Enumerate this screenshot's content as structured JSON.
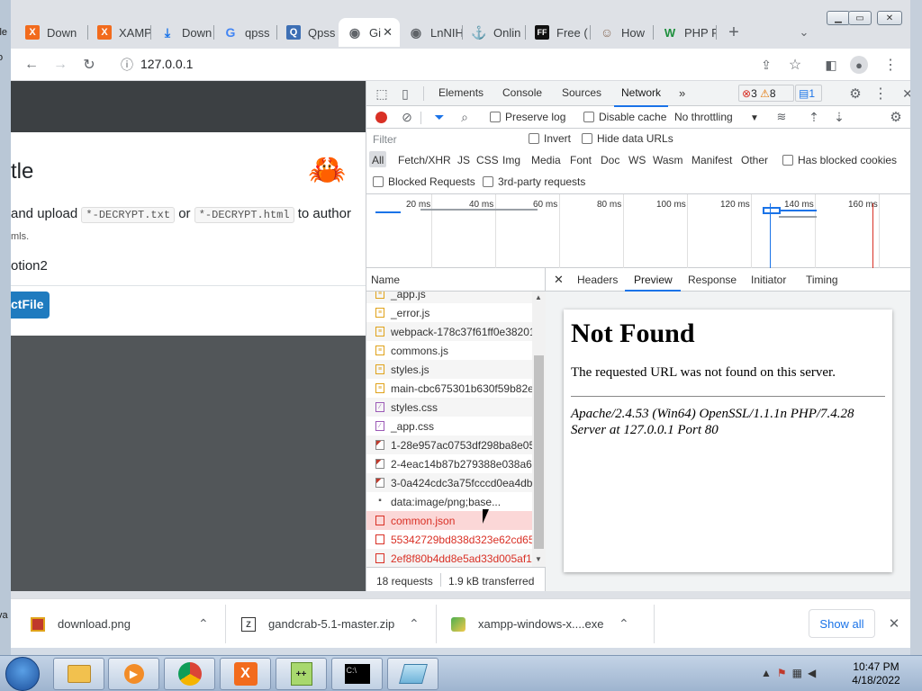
{
  "tabs": [
    {
      "label": "Down",
      "icon": "X",
      "icon_color": "#f26b1d"
    },
    {
      "label": "XAMP",
      "icon": "X",
      "icon_color": "#f26b1d"
    },
    {
      "label": "Down",
      "icon": "⤓",
      "icon_color": "#1a73e8"
    },
    {
      "label": "qpss",
      "icon": "G",
      "icon_color": "#4285f4"
    },
    {
      "label": "Qpss",
      "icon": "Q",
      "icon_color": "#e0403a"
    },
    {
      "label": "Gi",
      "icon": "◉",
      "icon_color": "#5f6368"
    },
    {
      "label": "LnNIH",
      "icon": "◉",
      "icon_color": "#5f6368"
    },
    {
      "label": "Onlin",
      "icon": "⚓",
      "icon_color": "#2e8b57"
    },
    {
      "label": "Free (",
      "icon": "FF",
      "icon_color": "#111111"
    },
    {
      "label": "How",
      "icon": "☺",
      "icon_color": "#8a6d5b"
    },
    {
      "label": "PHP F",
      "icon": "W",
      "icon_color": "#1d8f3c"
    }
  ],
  "toolbar": {
    "url": "127.0.0.1"
  },
  "page": {
    "title": "tle",
    "text_before": "and upload",
    "code1": "*-DECRYPT.txt",
    "or": "or",
    "code2": "*-DECRYPT.html",
    "text_after": "to author",
    "small": "mls.",
    "option": "otion2",
    "button": "ctFile"
  },
  "devtools": {
    "tabs": [
      "Elements",
      "Console",
      "Sources",
      "Network"
    ],
    "errors": "3",
    "warnings": "8",
    "messages": "1",
    "preserve_log": "Preserve log",
    "disable_cache": "Disable cache",
    "throttling": "No throttling",
    "filter_placeholder": "Filter",
    "invert": "Invert",
    "hide_data_urls": "Hide data URLs",
    "types": [
      "All",
      "Fetch/XHR",
      "JS",
      "CSS",
      "Img",
      "Media",
      "Font",
      "Doc",
      "WS",
      "Wasm",
      "Manifest",
      "Other"
    ],
    "has_blocked_cookies": "Has blocked cookies",
    "blocked_requests": "Blocked Requests",
    "third_party": "3rd-party requests",
    "ticks": [
      "20 ms",
      "40 ms",
      "60 ms",
      "80 ms",
      "100 ms",
      "120 ms",
      "140 ms",
      "160 ms"
    ],
    "name_header": "Name",
    "rows": [
      {
        "name": "_app.js",
        "type": "js",
        "state": "alt"
      },
      {
        "name": "_error.js",
        "type": "js",
        "state": ""
      },
      {
        "name": "webpack-178c37f61ff0e38201",
        "type": "js",
        "state": "alt"
      },
      {
        "name": "commons.js",
        "type": "js",
        "state": ""
      },
      {
        "name": "styles.js",
        "type": "js",
        "state": "alt"
      },
      {
        "name": "main-cbc675301b630f59b82e",
        "type": "js",
        "state": ""
      },
      {
        "name": "styles.css",
        "type": "css",
        "state": "alt"
      },
      {
        "name": "_app.css",
        "type": "css",
        "state": ""
      },
      {
        "name": "1-28e957ac0753df298ba8e05",
        "type": "img",
        "state": "alt"
      },
      {
        "name": "2-4eac14b87b279388e038a6",
        "type": "img",
        "state": ""
      },
      {
        "name": "3-0a424cdc3a75fcccd0ea4db",
        "type": "img",
        "state": "alt"
      },
      {
        "name": "data:image/png;base...",
        "type": "data",
        "state": ""
      },
      {
        "name": "common.json",
        "type": "err",
        "state": "selr"
      },
      {
        "name": "55342729bd838d323e62cd65",
        "type": "err",
        "state": ""
      },
      {
        "name": "2ef8f80b4dd8e5ad33d005af1",
        "type": "err",
        "state": "alt"
      }
    ],
    "requests": "18 requests",
    "transferred": "1.9 kB transferred",
    "preview_tabs": [
      "Headers",
      "Preview",
      "Response",
      "Initiator",
      "Timing"
    ],
    "preview": {
      "heading": "Not Found",
      "message": "The requested URL was not found on this server.",
      "address_line1": "Apache/2.4.53 (Win64) OpenSSL/1.1.1n PHP/7.4.28",
      "address_line2": "Server at 127.0.0.1 Port 80"
    }
  },
  "downloads": [
    {
      "name": "download.png"
    },
    {
      "name": "gandcrab-5.1-master.zip"
    },
    {
      "name": "xampp-windows-x....exe"
    }
  ],
  "show_all": "Show all",
  "clock": {
    "time": "10:47 PM",
    "date": "4/18/2022"
  },
  "desktop_fragments": [
    "ile",
    "o",
    "va"
  ]
}
